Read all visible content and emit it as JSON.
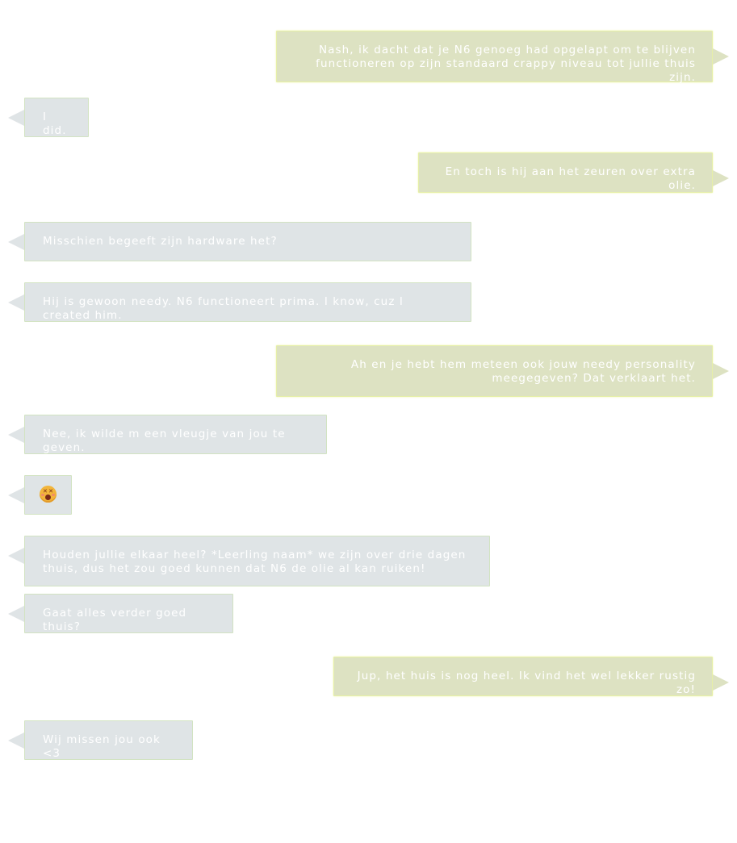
{
  "chat": {
    "messages": [
      {
        "direction": "outgoing",
        "text": "Nash, ik dacht dat je N6 genoeg had opgelapt om te blijven functioneren op zijn standaard crappy niveau tot jullie thuis zijn."
      },
      {
        "direction": "incoming",
        "text": "I did."
      },
      {
        "direction": "outgoing",
        "text": "En toch is hij aan het zeuren over extra olie."
      },
      {
        "direction": "incoming",
        "text": "Misschien begeeft zijn hardware het?"
      },
      {
        "direction": "incoming",
        "text": "Hij is gewoon needy. N6 functioneert prima. I know, cuz I created him."
      },
      {
        "direction": "outgoing",
        "text": "Ah en je hebt hem meteen ook jouw needy personality meegegeven? Dat verklaart het."
      },
      {
        "direction": "incoming",
        "text": "Nee, ik wilde m een vleugje van jou te geven."
      },
      {
        "direction": "incoming",
        "emoji": "dizzy-face-emoji"
      },
      {
        "direction": "incoming",
        "text": "Houden jullie elkaar heel? *Leerling naam* we zijn over drie dagen thuis, dus het zou goed kunnen dat N6 de olie al kan ruiken!"
      },
      {
        "direction": "incoming",
        "text": "Gaat alles verder goed thuis?"
      },
      {
        "direction": "outgoing",
        "text": "Jup, het huis is nog heel. Ik vind het wel lekker rustig zo!"
      },
      {
        "direction": "incoming",
        "text": "Wij missen jou ook <3"
      }
    ]
  },
  "colors": {
    "incoming_bubble": "#dfe4e6",
    "outgoing_bubble": "#dde2c2",
    "text": "#ffffff",
    "background": "#ffffff"
  }
}
